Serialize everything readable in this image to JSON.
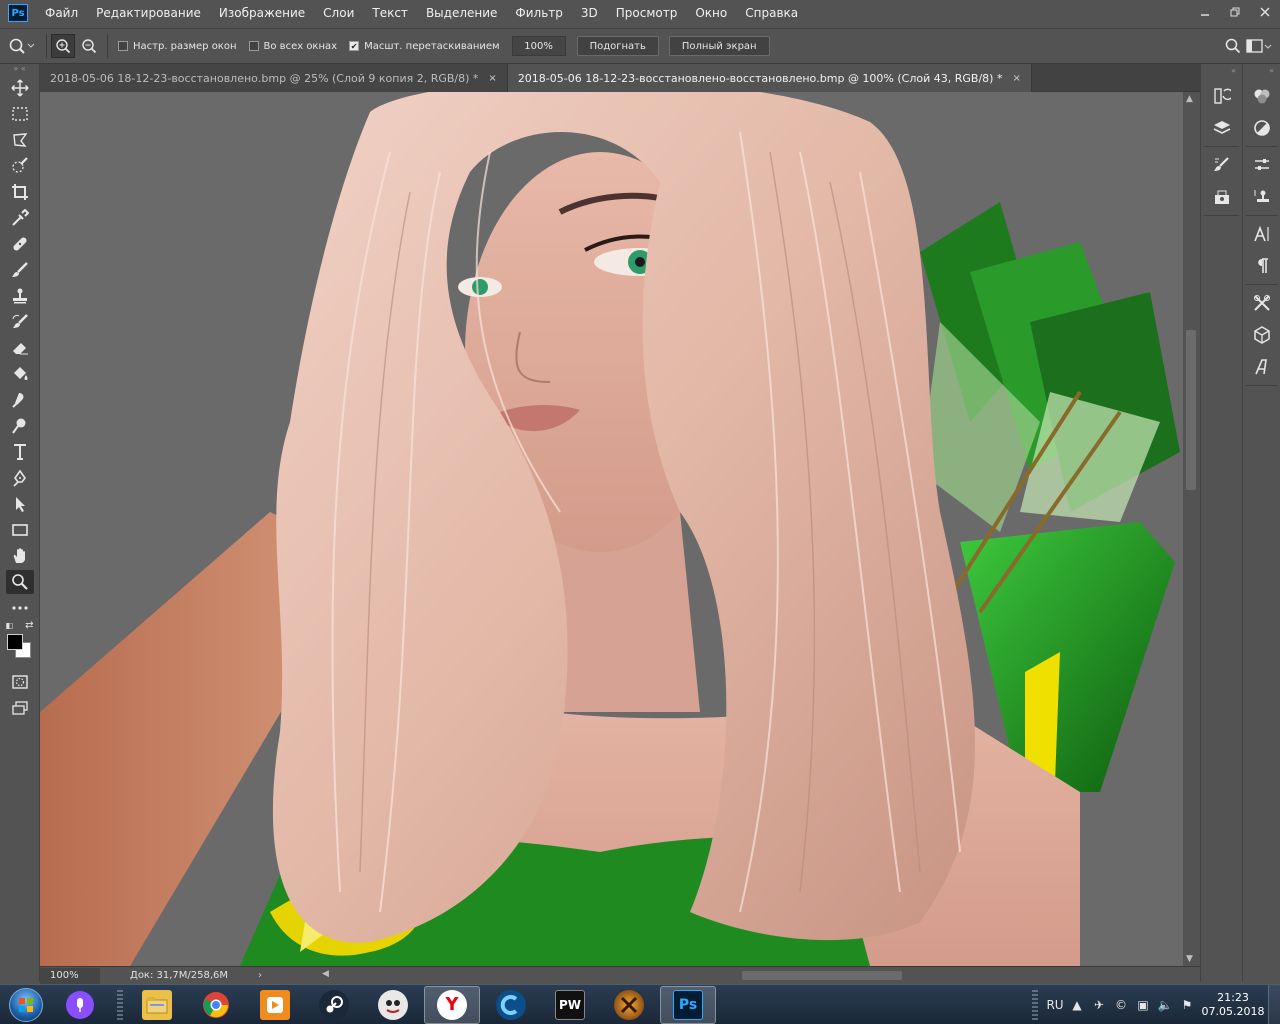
{
  "menu": [
    "Файл",
    "Редактирование",
    "Изображение",
    "Слои",
    "Текст",
    "Выделение",
    "Фильтр",
    "3D",
    "Просмотр",
    "Окно",
    "Справка"
  ],
  "app_logo": "Ps",
  "window_controls": [
    "minimize-icon",
    "restore-icon",
    "close-icon"
  ],
  "options": {
    "resize_windows": {
      "label": "Настр. размер окон",
      "checked": false
    },
    "all_windows": {
      "label": "Во всех окнах",
      "checked": false
    },
    "scrubby_zoom": {
      "label": "Масшт. перетаскиванием",
      "checked": true
    },
    "zoom_value": "100%",
    "fit_button": "Подогнать",
    "fullscreen_button": "Полный экран"
  },
  "tabs": [
    {
      "title": "2018-05-06 18-12-23-восстановлено.bmp @ 25% (Слой 9 копия 2, RGB/8) *",
      "active": false
    },
    {
      "title": "2018-05-06 18-12-23-восстановлено-восстановлено.bmp @ 100% (Слой 43, RGB/8) *",
      "active": true
    }
  ],
  "tab_close": "×",
  "status": {
    "zoom": "100%",
    "doc": "Док: 31,7M/258,6M",
    "arrow": "›"
  },
  "tools": [
    "move-icon",
    "marquee-icon",
    "lasso-icon",
    "quick-select-icon",
    "crop-icon",
    "eyedropper-icon",
    "healing-icon",
    "brush-icon",
    "stamp-icon",
    "history-brush-icon",
    "eraser-icon",
    "paint-bucket-icon",
    "smudge-icon",
    "dodge-icon",
    "type-icon",
    "pen-icon",
    "path-select-icon",
    "rectangle-icon",
    "hand-icon",
    "zoom-icon",
    "more-tools-icon"
  ],
  "active_tool": "zoom-icon",
  "panels_a": [
    "history-icon",
    "layers-icon",
    "brushes-icon",
    "3d-materials-icon"
  ],
  "panels_b": [
    "color-icon",
    "adjustments-icon",
    "properties-icon",
    "clone-source-icon",
    "character-icon",
    "paragraph-icon",
    "tools-preset-icon",
    "3d-icon",
    "glyphs-icon"
  ],
  "taskbar": {
    "apps": [
      {
        "name": "alice-voice-icon",
        "active": false
      },
      {
        "name": "file-explorer-icon",
        "active": false
      },
      {
        "name": "chrome-icon",
        "active": false
      },
      {
        "name": "media-player-icon",
        "active": false
      },
      {
        "name": "steam-icon",
        "active": false
      },
      {
        "name": "game-mascot-icon",
        "active": false
      },
      {
        "name": "yandex-browser-icon",
        "active": false
      },
      {
        "name": "launcher-c-icon",
        "active": false
      },
      {
        "name": "perfect-world-icon",
        "active": false
      },
      {
        "name": "mmo-game-icon",
        "active": false
      },
      {
        "name": "photoshop-icon",
        "active": true
      }
    ],
    "app_glyphs": {
      "yandex": "Y",
      "perfect_world": "PW",
      "photoshop": "Ps"
    },
    "lang": "RU",
    "time": "21:23",
    "date": "07.05.2018"
  },
  "colors": {
    "accent": "#31a8ff",
    "ui_bg": "#535353",
    "canvas_bg": "#6a6a6a",
    "hair": "#e8c2b2",
    "green": "#1f8a1f"
  }
}
